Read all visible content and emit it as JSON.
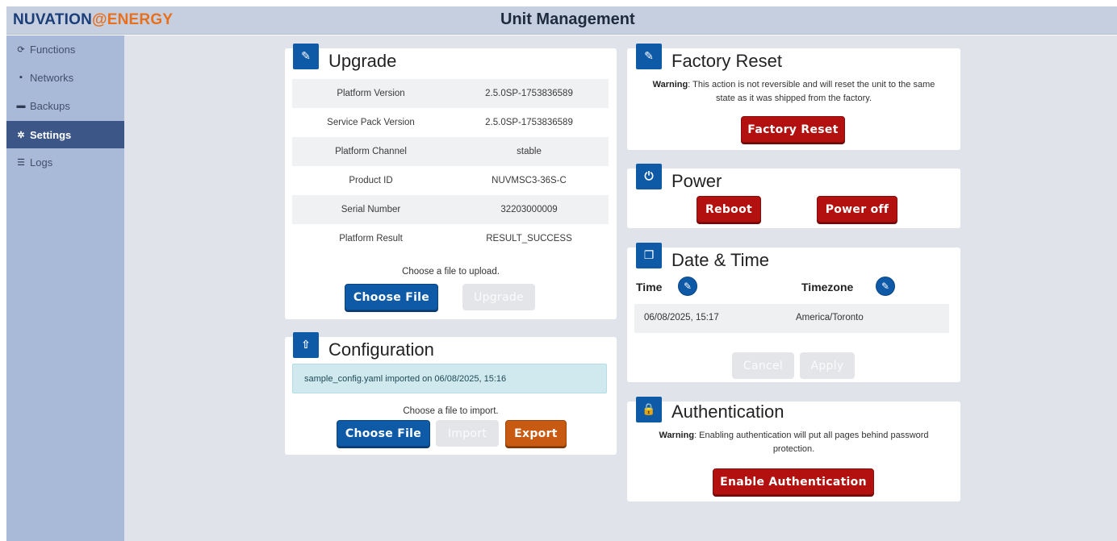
{
  "header": {
    "logo_nuvation": "NUVATION",
    "logo_at": "@",
    "logo_energy": "ENERGY",
    "title": "Unit Management"
  },
  "sidebar": {
    "items": [
      {
        "label": "Functions",
        "icon": "refresh-icon",
        "glyph": "⟳",
        "active": false
      },
      {
        "label": "Networks",
        "icon": "network-icon",
        "glyph": "▪",
        "active": false
      },
      {
        "label": "Backups",
        "icon": "hdd-icon",
        "glyph": "▬",
        "active": false
      },
      {
        "label": "Settings",
        "icon": "gear-icon",
        "glyph": "✲",
        "active": true
      },
      {
        "label": "Logs",
        "icon": "list-icon",
        "glyph": "☰",
        "active": false
      }
    ]
  },
  "upgrade": {
    "title": "Upgrade",
    "rows": [
      {
        "key": "Platform Version",
        "value": "2.5.0SP-1753836589"
      },
      {
        "key": "Service Pack Version",
        "value": "2.5.0SP-1753836589"
      },
      {
        "key": "Platform Channel",
        "value": "stable"
      },
      {
        "key": "Product ID",
        "value": "NUVMSC3-36S-C"
      },
      {
        "key": "Serial Number",
        "value": "32203000009"
      },
      {
        "key": "Platform Result",
        "value": "RESULT_SUCCESS"
      }
    ],
    "hint": "Choose a file to upload.",
    "choose_label": "Choose File",
    "upgrade_label": "Upgrade"
  },
  "configuration": {
    "title": "Configuration",
    "alert": "sample_config.yaml imported on 06/08/2025, 15:16",
    "hint": "Choose a file to import.",
    "choose_label": "Choose File",
    "import_label": "Import",
    "export_label": "Export"
  },
  "factory_reset": {
    "title": "Factory Reset",
    "warning_bold": "Warning",
    "warning_line1": ": This action is not reversible and will reset the unit to the same",
    "warning_line2": "state as it was shipped from the factory.",
    "button_label": "Factory Reset"
  },
  "power": {
    "title": "Power",
    "reboot_label": "Reboot",
    "poweroff_label": "Power off"
  },
  "datetime": {
    "title": "Date & Time",
    "time_label": "Time",
    "timezone_label": "Timezone",
    "time_value": "06/08/2025, 15:17",
    "timezone_value": "America/Toronto",
    "cancel_label": "Cancel",
    "apply_label": "Apply"
  },
  "authentication": {
    "title": "Authentication",
    "warning_bold": "Warning",
    "warning_line1": ": Enabling authentication will put all pages behind password",
    "warning_line2": "protection.",
    "button_label": "Enable Authentication"
  },
  "colors": {
    "primary": "#0e5aa7",
    "danger": "#b3110f",
    "warning": "#c85a12",
    "sidebar": "#a8bad8",
    "sidebar_active": "#3b5687"
  }
}
